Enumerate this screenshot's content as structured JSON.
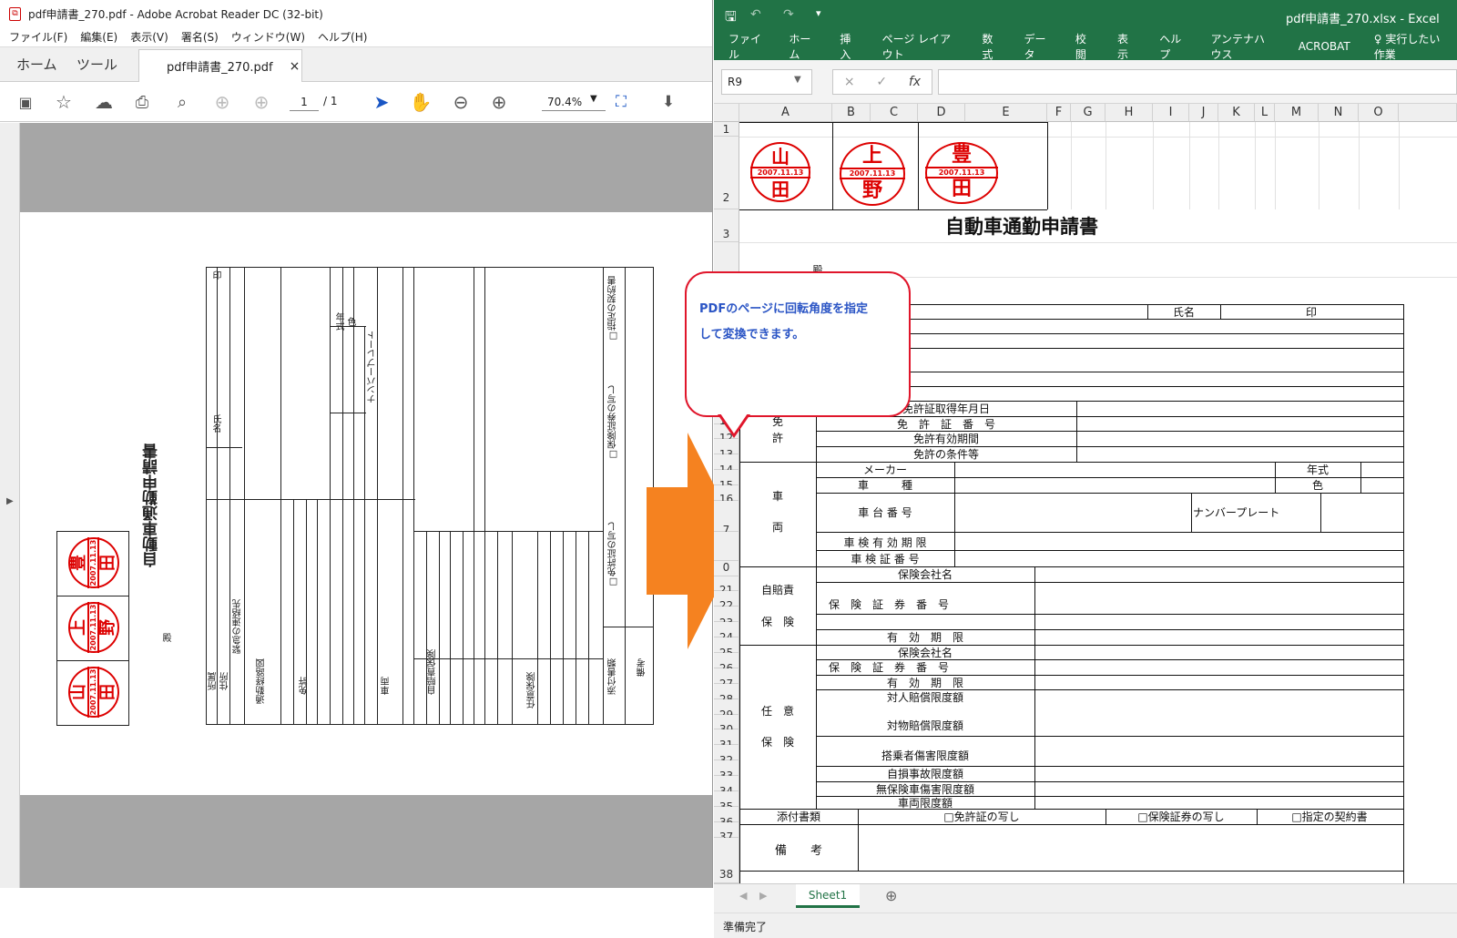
{
  "acrobat": {
    "title": "pdf申請書_270.pdf - Adobe Acrobat Reader DC (32-bit)",
    "menu": [
      "ファイル(F)",
      "編集(E)",
      "表示(V)",
      "署名(S)",
      "ウィンドウ(W)",
      "ヘルプ(H)"
    ],
    "tabs": {
      "home": "ホーム",
      "tools": "ツール",
      "file": "pdf申請書_270.pdf",
      "close": "×"
    },
    "page_current": "1",
    "page_total": "/ 1",
    "zoom": "70.4%",
    "icons": [
      "save-icon",
      "star-icon",
      "upload-icon",
      "print-icon",
      "zoom-out-search-icon",
      "page-up-icon",
      "page-down-icon",
      "select-cursor-icon",
      "hand-icon",
      "minus-circle-icon",
      "plus-circle-icon",
      "fit-page-icon",
      "scroll-mode-icon"
    ]
  },
  "pdf": {
    "title": "自動車通勤申請書",
    "school": "殿",
    "labels": [
      "印",
      "氏名",
      "年式",
      "色",
      "ナンバープレート",
      "□指定の契約書",
      "□保険証券の写し",
      "□免許証の写し",
      "所属",
      "住所",
      "緊急の連絡先",
      "通勤経路図",
      "免許",
      "車両",
      "自賠責保険",
      "任意保険",
      "添付書類",
      "備考"
    ],
    "stamps": [
      {
        "top": "豊",
        "bottom": "田",
        "date": "2007.11.13"
      },
      {
        "top": "上",
        "bottom": "野",
        "date": "2007.11.13"
      },
      {
        "top": "山",
        "bottom": "田",
        "date": "2007.11.13"
      }
    ]
  },
  "excel": {
    "title": "pdf申請書_270.xlsx  -  Excel",
    "ribbon": [
      "ファイル",
      "ホーム",
      "挿入",
      "ページ レイアウト",
      "数式",
      "データ",
      "校閲",
      "表示",
      "ヘルプ",
      "アンテナハウス",
      "ACROBAT",
      "♀ 実行したい作業"
    ],
    "namebox": "R9",
    "fx": [
      "×",
      "✓",
      "fx"
    ],
    "columns": [
      "A",
      "B",
      "C",
      "D",
      "E",
      "F",
      "G",
      "H",
      "I",
      "J",
      "K",
      "L",
      "M",
      "N",
      "O"
    ],
    "rows": [
      "1",
      "2",
      "3",
      "",
      "",
      "",
      "",
      "",
      "",
      "",
      "11",
      "12",
      "13",
      "14",
      "15",
      "16",
      "7",
      "",
      "0",
      "21",
      "22",
      "23",
      "24",
      "25",
      "26",
      "27",
      "28",
      "29",
      "30",
      "31",
      "32",
      "33",
      "34",
      "35",
      "36",
      "37",
      "38"
    ],
    "sheet_tab": "Sheet1",
    "status": "準備完了",
    "form": {
      "title": "自動車通勤申請書",
      "dono": "殿",
      "shimei": "氏名",
      "in": "印",
      "license": [
        "免許証取得年月日",
        "免　許　証　番　号",
        "免許有効期間",
        "免許の条件等"
      ],
      "license_label": [
        "免",
        "許"
      ],
      "car": [
        "メーカー",
        "車　　　種",
        "車 台 番 号",
        "車 検 有 効 期 限",
        "車 検 証 番 号"
      ],
      "car_label": [
        "車",
        "両"
      ],
      "nenshiki": "年式",
      "iro": "色",
      "number": "ナンバープレート",
      "jibai": [
        "保険会社名",
        "保　険　証　券　番　号",
        "有　効　期　限"
      ],
      "jibai_label": [
        "自賠責",
        "保　険"
      ],
      "nini": [
        "保険会社名",
        "保　険　証　券　番　号",
        "有　効　期　限",
        "対人賠償限度額",
        "対物賠償限度額",
        "搭乗者傷害限度額",
        "自損事故限度額",
        "無保険車傷害限度額",
        "車両限度額"
      ],
      "nini_label": [
        "任　意",
        "保　険"
      ],
      "attach": "添付書類",
      "attach_items": [
        "□免許証の写し",
        "□保険証券の写し",
        "□指定の契約書"
      ],
      "biko": "備　　考"
    }
  },
  "callout": {
    "line1": "PDFのページに回転角度を指定",
    "line2": "して変換できます。"
  },
  "arrow_color": "#f58220"
}
